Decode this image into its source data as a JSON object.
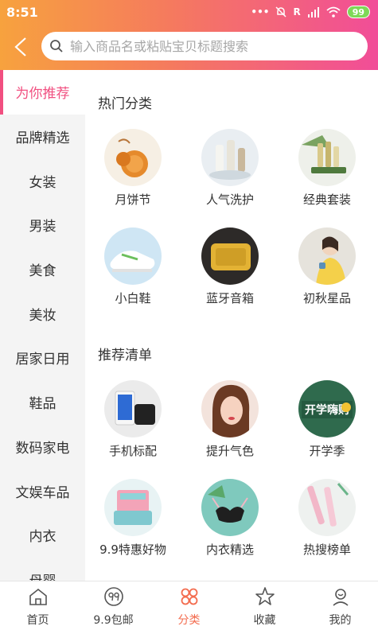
{
  "status_bar": {
    "time": "8:51",
    "signal": "R",
    "battery": "99"
  },
  "search": {
    "placeholder": "输入商品名或粘贴宝贝标题搜索"
  },
  "sidebar": {
    "items": [
      {
        "label": "为你推荐"
      },
      {
        "label": "品牌精选"
      },
      {
        "label": "女装"
      },
      {
        "label": "男装"
      },
      {
        "label": "美食"
      },
      {
        "label": "美妆"
      },
      {
        "label": "居家日用"
      },
      {
        "label": "鞋品"
      },
      {
        "label": "数码家电"
      },
      {
        "label": "文娱车品"
      },
      {
        "label": "内衣"
      },
      {
        "label": "母婴"
      }
    ]
  },
  "sections": [
    {
      "title": "热门分类",
      "items": [
        {
          "label": "月饼节"
        },
        {
          "label": "人气洗护"
        },
        {
          "label": "经典套装"
        },
        {
          "label": "小白鞋"
        },
        {
          "label": "蓝牙音箱"
        },
        {
          "label": "初秋星品"
        }
      ]
    },
    {
      "title": "推荐清单",
      "items": [
        {
          "label": "手机标配"
        },
        {
          "label": "提升气色"
        },
        {
          "label": "开学季",
          "image_text": "开学嗨购"
        },
        {
          "label": "9.9特惠好物"
        },
        {
          "label": "内衣精选"
        },
        {
          "label": "热搜榜单"
        }
      ]
    }
  ],
  "bottom_nav": {
    "items": [
      {
        "label": "首页",
        "icon": "home-icon"
      },
      {
        "label": "9.9包邮",
        "icon": "ninety-nine-icon"
      },
      {
        "label": "分类",
        "icon": "category-icon"
      },
      {
        "label": "收藏",
        "icon": "star-icon"
      },
      {
        "label": "我的",
        "icon": "user-icon"
      }
    ]
  },
  "colors": {
    "accent": "#f14f80",
    "nav_active": "#f36c4f",
    "gradient_start": "#f7a23e",
    "gradient_end": "#f14d98"
  }
}
